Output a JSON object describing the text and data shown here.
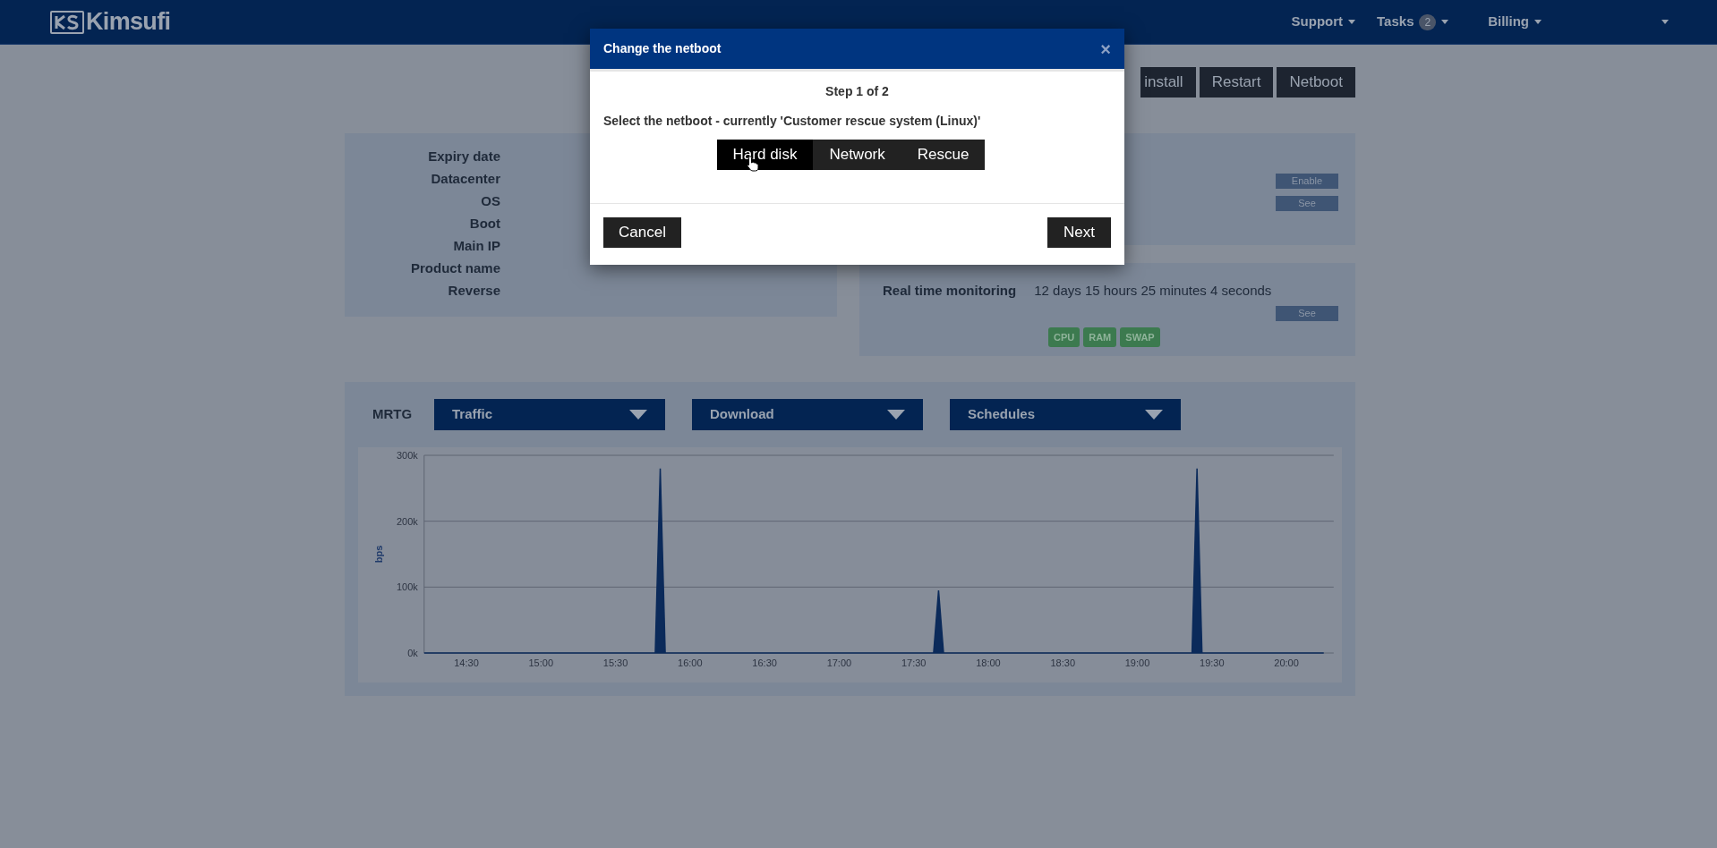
{
  "header": {
    "logo": "Kimsufi",
    "nav": [
      {
        "kind": "menu",
        "label": "Support"
      },
      {
        "kind": "menu",
        "label": "Tasks",
        "badge": "2"
      },
      {
        "kind": "menu",
        "label": "Billing"
      },
      {
        "kind": "caret"
      }
    ]
  },
  "actions": [
    "install",
    "Restart",
    "Netboot"
  ],
  "server_info": {
    "labels": [
      "Expiry date",
      "Datacenter",
      "OS",
      "Boot",
      "Main IP",
      "Product name",
      "Reverse"
    ]
  },
  "options_panel": {
    "buttons": [
      "Enable",
      "See"
    ]
  },
  "monitoring": {
    "label": "Real time monitoring",
    "value": "12 days 15 hours 25 minutes 4 seconds",
    "button": "See",
    "badges": [
      "CPU",
      "RAM",
      "SWAP"
    ]
  },
  "mrtg": {
    "label": "MRTG",
    "dropdowns": [
      "Traffic",
      "Download",
      "Schedules"
    ],
    "chart_data": {
      "type": "area",
      "ylabel": "bps",
      "x": [
        854,
        946,
        948,
        950,
        1058,
        1060,
        1062,
        1162,
        1164,
        1166,
        1215
      ],
      "xlim": [
        853,
        1219
      ],
      "series": [
        {
          "color": "#0b2a5a",
          "values": [
            0,
            0,
            280000,
            0,
            0,
            95000,
            0,
            0,
            280000,
            0,
            0
          ]
        }
      ],
      "ylim": [
        0,
        300000
      ],
      "xticks": [
        {
          "value": 870,
          "label": "14:30"
        },
        {
          "value": 900,
          "label": "15:00"
        },
        {
          "value": 930,
          "label": "15:30"
        },
        {
          "value": 960,
          "label": "16:00"
        },
        {
          "value": 990,
          "label": "16:30"
        },
        {
          "value": 1020,
          "label": "17:00"
        },
        {
          "value": 1050,
          "label": "17:30"
        },
        {
          "value": 1080,
          "label": "18:00"
        },
        {
          "value": 1110,
          "label": "18:30"
        },
        {
          "value": 1140,
          "label": "19:00"
        },
        {
          "value": 1170,
          "label": "19:30"
        },
        {
          "value": 1200,
          "label": "20:00"
        }
      ],
      "yticks": [
        {
          "value": 0,
          "label": "0k"
        },
        {
          "value": 100000,
          "label": "100k"
        },
        {
          "value": 200000,
          "label": "200k"
        },
        {
          "value": 300000,
          "label": "300k"
        }
      ]
    }
  },
  "modal": {
    "title": "Change the netboot",
    "close": "×",
    "step": "Step 1 of 2",
    "prompt": "Select the netboot - currently 'Customer rescue system (Linux)'",
    "options": [
      {
        "label": "Hard disk",
        "selected": true
      },
      {
        "label": "Network",
        "selected": false
      },
      {
        "label": "Rescue",
        "selected": false
      }
    ],
    "cancel": "Cancel",
    "next": "Next"
  }
}
